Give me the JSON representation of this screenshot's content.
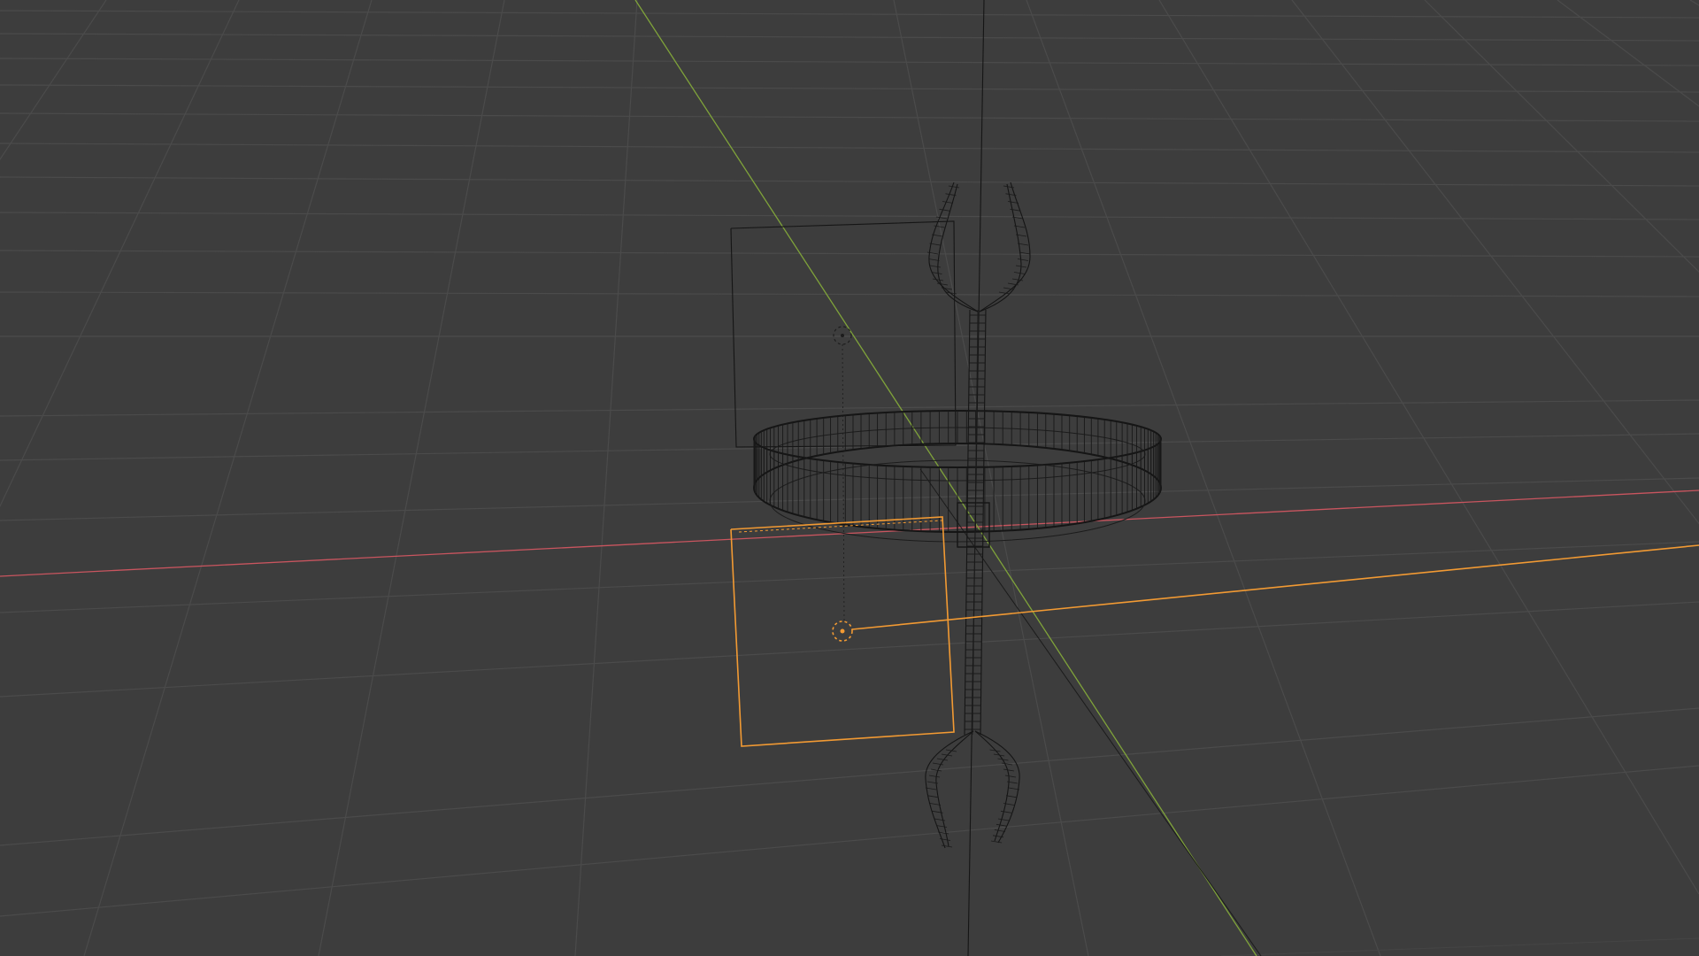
{
  "viewport": {
    "view": "3D Viewport",
    "shading": "wireframe",
    "background_color": "#3d3d3d",
    "grid_color": "#4b4b4b",
    "x_axis_color": "#c9555f",
    "y_axis_color": "#7fa33a",
    "selection_color": "#f29a33",
    "wire_color": "#151515"
  },
  "scene": {
    "objects": [
      {
        "name": "ring",
        "type": "mesh",
        "selected": false
      },
      {
        "name": "fork-rod",
        "type": "mesh",
        "selected": false
      },
      {
        "name": "light-upper",
        "type": "light",
        "selected": false
      },
      {
        "name": "light-lower",
        "type": "light",
        "selected": true
      }
    ]
  }
}
